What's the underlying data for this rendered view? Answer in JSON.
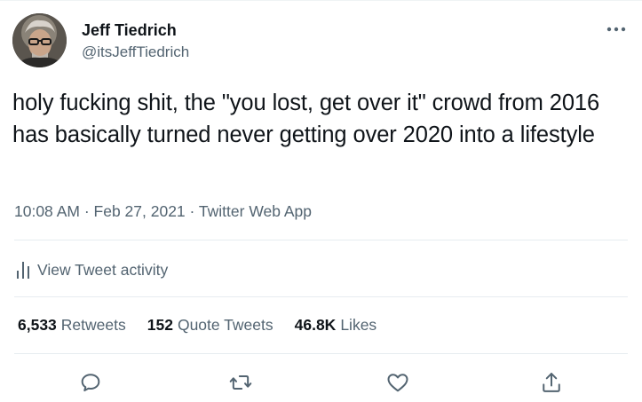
{
  "author": {
    "display_name": "Jeff Tiedrich",
    "handle": "@itsJeffTiedrich"
  },
  "tweet": {
    "text": "holy fucking shit, the \"you lost, get over it\" crowd from 2016 has basically turned never getting over 2020 into a lifestyle",
    "time": "10:08 AM",
    "separator": "·",
    "date": "Feb 27, 2021",
    "source": "Twitter Web App"
  },
  "activity": {
    "label": "View Tweet activity"
  },
  "stats": {
    "retweets_count": "6,533",
    "retweets_label": "Retweets",
    "quotes_count": "152",
    "quotes_label": "Quote Tweets",
    "likes_count": "46.8K",
    "likes_label": "Likes"
  },
  "actions": {
    "reply_icon": "reply-icon",
    "retweet_icon": "retweet-icon",
    "like_icon": "heart-icon",
    "share_icon": "share-icon"
  },
  "colors": {
    "text_primary": "#0f1419",
    "text_secondary": "#536471",
    "divider": "#e6ecf0",
    "accent": "#1d9bf0"
  }
}
